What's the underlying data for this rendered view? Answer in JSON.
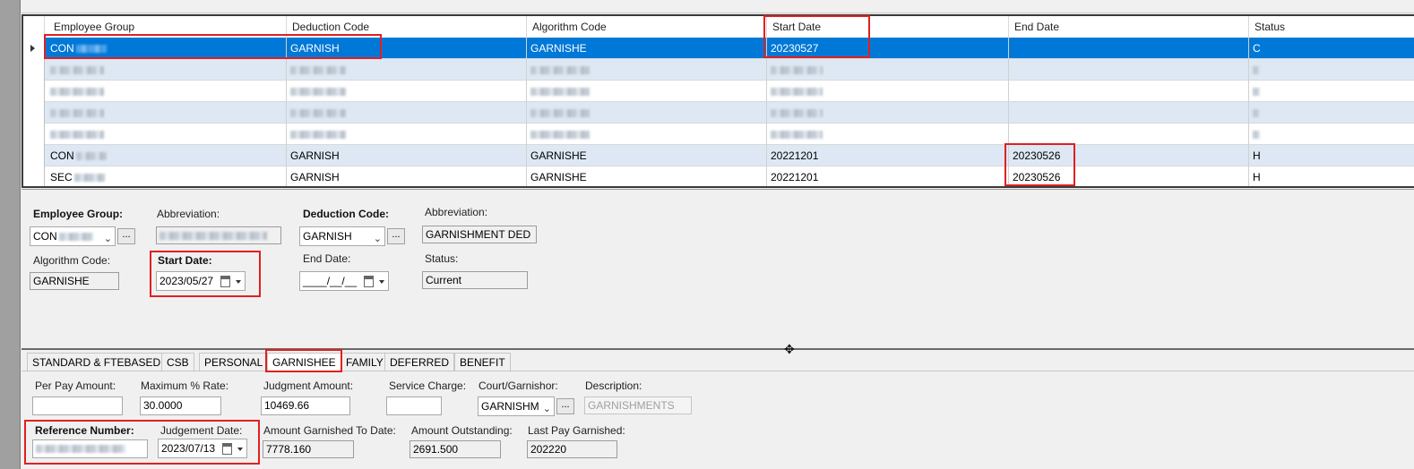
{
  "grid": {
    "columns": [
      "Employee Group",
      "Deduction Code",
      "Algorithm Code",
      "Start Date",
      "End Date",
      "Status"
    ],
    "rows": [
      {
        "group": "CON",
        "deduction": "GARNISH",
        "algorithm": "GARNISHE",
        "start": "20230527",
        "end": "",
        "status": "C",
        "selected": true
      },
      {
        "group": "",
        "deduction": "",
        "algorithm": "",
        "start": "",
        "end": "",
        "status": "",
        "redacted": true
      },
      {
        "group": "",
        "deduction": "",
        "algorithm": "",
        "start": "",
        "end": "",
        "status": "",
        "redacted": true
      },
      {
        "group": "",
        "deduction": "",
        "algorithm": "",
        "start": "",
        "end": "",
        "status": "",
        "redacted": true
      },
      {
        "group": "",
        "deduction": "",
        "algorithm": "",
        "start": "",
        "end": "",
        "status": "",
        "redacted": true
      },
      {
        "group": "CON",
        "deduction": "GARNISH",
        "algorithm": "GARNISHE",
        "start": "20221201",
        "end": "20230526",
        "status": "H"
      },
      {
        "group": "SEC",
        "deduction": "GARNISH",
        "algorithm": "GARNISHE",
        "start": "20221201",
        "end": "20230526",
        "status": "H"
      }
    ]
  },
  "detail": {
    "employee_group_label": "Employee Group:",
    "employee_group_value": "CON",
    "abbreviation_label": "Abbreviation:",
    "deduction_code_label": "Deduction Code:",
    "deduction_code_value": "GARNISH",
    "deduction_abbrev_label": "Abbreviation:",
    "deduction_abbrev_value": "GARNISHMENT DED",
    "algorithm_code_label": "Algorithm Code:",
    "algorithm_code_value": "GARNISHE",
    "start_date_label": "Start Date:",
    "start_date_value": "2023/05/27",
    "end_date_label": "End Date:",
    "end_date_value": "____/__/__",
    "status_label": "Status:",
    "status_value": "Current",
    "ellipsis": "..."
  },
  "tabs": [
    {
      "label": "STANDARD & FTEBASED",
      "active": false
    },
    {
      "label": "CSB",
      "active": false
    },
    {
      "label": "PERSONAL",
      "active": false
    },
    {
      "label": "GARNISHEE",
      "active": true
    },
    {
      "label": "FAMILY",
      "active": false
    },
    {
      "label": "DEFERRED",
      "active": false
    },
    {
      "label": "BENEFIT",
      "active": false
    }
  ],
  "garnishee": {
    "per_pay_amount_label": "Per Pay Amount:",
    "per_pay_amount_value": "",
    "max_rate_label": "Maximum % Rate:",
    "max_rate_value": "30.0000",
    "judgment_amount_label": "Judgment Amount:",
    "judgment_amount_value": "10469.66",
    "service_charge_label": "Service Charge:",
    "service_charge_value": "",
    "court_label": "Court/Garnishor:",
    "court_value": "GARNISHM",
    "description_label": "Description:",
    "description_value": "GARNISHMENTS",
    "reference_number_label": "Reference Number:",
    "judgement_date_label": "Judgement Date:",
    "judgement_date_value": "2023/07/13",
    "amount_garnished_label": "Amount Garnished To Date:",
    "amount_garnished_value": "7778.160",
    "amount_outstanding_label": "Amount Outstanding:",
    "amount_outstanding_value": "2691.500",
    "last_pay_label": "Last Pay Garnished:",
    "last_pay_value": "202220"
  },
  "colors": {
    "selection": "#0078d7",
    "alt_row": "#dde8f4",
    "highlight": "#e02020"
  }
}
